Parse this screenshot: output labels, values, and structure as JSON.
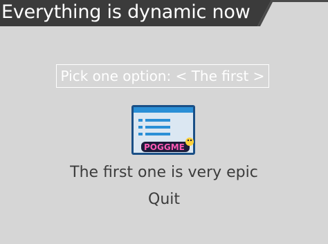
{
  "window": {
    "title": "Everything is dynamic now"
  },
  "picker": {
    "label": "Pick one option: < The first >"
  },
  "preview": {
    "icon": "list-window-icon",
    "badge_text": "POGGME"
  },
  "description": {
    "text": "The first one is very epic"
  },
  "actions": {
    "quit_label": "Quit"
  },
  "colors": {
    "background": "#d6d6d6",
    "title_bar": "#3b3b3b",
    "text": "#3c3c3c",
    "highlight": "#ffffff",
    "icon_blue": "#2a8fd6"
  }
}
